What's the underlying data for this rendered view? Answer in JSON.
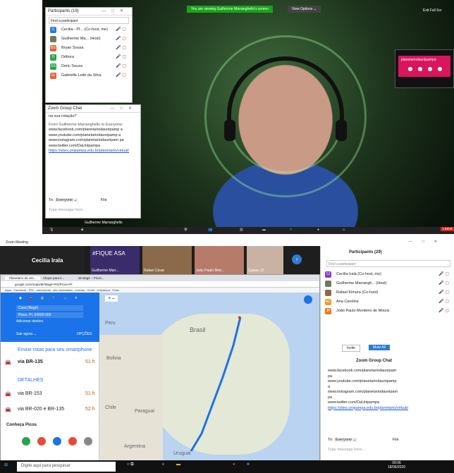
{
  "top": {
    "viewing_banner": "You are viewing Guilherme Marranghello's screen",
    "view_options": "View Options ⌄",
    "exit_full": "Exit Full Scr",
    "logo_text": "planetariodaunipampa",
    "speaker_name": "Guilherme Marranghello",
    "participants_panel": {
      "title": "Participants (19)",
      "search_placeholder": "Find a participant",
      "rows": [
        {
          "initials": "C",
          "color": "#2d7cd3",
          "name": "Cecilia - Pl... (Co-host, me)"
        },
        {
          "initials": "",
          "color": "#6d7a5e",
          "name": "Guilherme Ma... (Host)"
        },
        {
          "initials": "BS",
          "color": "#e0623a",
          "name": "Bryan Sousa"
        },
        {
          "initials": "D",
          "color": "#2aa24b",
          "name": "Débora"
        },
        {
          "initials": "DS",
          "color": "#2aa24b",
          "name": "Deric Souza"
        },
        {
          "initials": "GL",
          "color": "#e0623a",
          "name": "Gabrielle Leite da Silva"
        }
      ]
    },
    "chat_panel": {
      "title": "Zoom Group Chat",
      "line1": "na sua rotação?",
      "from": "From Guilherme Marranghello to Everyone:",
      "url1": "www.facebook.com/planetariodaunipamp a",
      "url2": "www.youtube.com/planetariodaunipamp a",
      "url3": "www.instagram.com/planetariodaunipam pa",
      "url4": "www.twitter.com/DaUnipampa",
      "url5": "https://sites.unipampa.edu.br/planetario/virtual/",
      "to_label": "To:",
      "to_value": "Everyone ⌄",
      "file": "File",
      "placeholder": "Type message here..."
    }
  },
  "bottom": {
    "window_title": "Zoom Meeting",
    "thumbs": [
      {
        "name": "Cecilia Irala",
        "big": "Cecilia Irala"
      },
      {
        "name": "Guilherme Marr...",
        "big": "#FIQUE  ASA"
      },
      {
        "name": "Rafael César",
        "big": ""
      },
      {
        "name": "João Paulo Mon...",
        "big": ""
      },
      {
        "name": "Galaxy J2",
        "big": ""
      }
    ],
    "map": {
      "from": "Casa (Bagé)",
      "to": "Picos, PI, 64600-000",
      "add_dest": "Adicionar destino",
      "leave": "Sair agora ⌄",
      "options": "OPÇÕES",
      "send": "Enviar rotas para seu smartphone",
      "route1": "via BR-135",
      "route1_time": "51 h",
      "route2": "via BR-153",
      "route2_time": "51 h",
      "route3": "via BR-020 e BR-135",
      "route3_time": "52 h",
      "details": "DETALHES",
      "know": "Conheça Picos",
      "country": "Brasil",
      "labels": [
        "Bolivia",
        "Paraguai",
        "Chile",
        "Argentina",
        "Uruguai",
        "Peru"
      ]
    },
    "participants": {
      "title": "Participants (29)",
      "search_placeholder": "Find a participant",
      "rows": [
        {
          "initials": "CI",
          "color": "#8a3ad0",
          "name": "Cecilia Irala (Co-host, me)"
        },
        {
          "initials": "",
          "color": "#6d7a5e",
          "name": "Guilherme Marrangh... (Host)"
        },
        {
          "initials": "",
          "color": "#8a6a4a",
          "name": "Rafael Kimura (Co-host)"
        },
        {
          "initials": "AC",
          "color": "#f09a2a",
          "name": "Ana Caroline"
        },
        {
          "initials": "JP",
          "color": "#f07a1a",
          "name": "João Paulo Monteiro de Moura"
        }
      ],
      "invite": "Invite",
      "mute_all": "Mute All"
    },
    "chat": {
      "title": "Zoom Group Chat",
      "url0": "www.facebook.com/planetariodaunipam",
      "url0b": "pa",
      "url1": "www.youtube.com/planetariodaunipamp",
      "url1b": "a",
      "url2": "www.instagram.com/planetariodaunipam",
      "url2b": "pa",
      "url3": "www.twitter.com/DaUnipampa",
      "url4": "https://sites.unipampa.edu.br/planetario/virtual/",
      "to_label": "To:",
      "to_value": "Everyone ⌄",
      "file": "File",
      "placeholder": "Type message here..."
    },
    "taskbar": {
      "search": "Digite aqui para pesquisar",
      "time": "09:06",
      "date": "18/06/2020"
    }
  }
}
